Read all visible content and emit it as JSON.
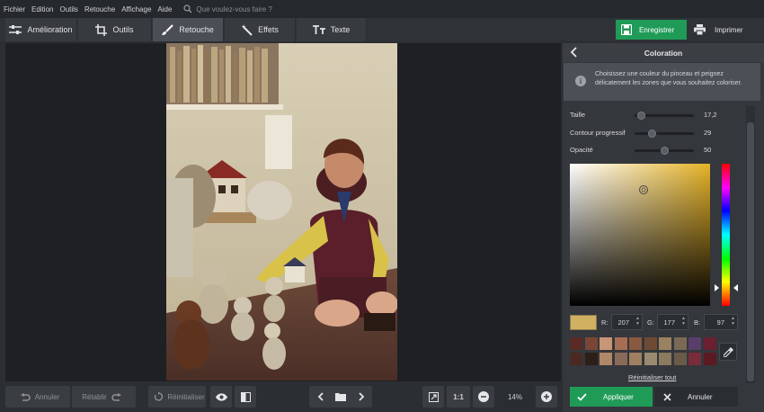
{
  "menu": [
    "Fichier",
    "Edition",
    "Outils",
    "Retouche",
    "Affichage",
    "Aide"
  ],
  "search": {
    "placeholder": "Que voulez-vous faire ?"
  },
  "tabs": [
    {
      "label": "Amélioration",
      "icon": "sliders-icon",
      "active": false
    },
    {
      "label": "Outils",
      "icon": "crop-icon",
      "active": false
    },
    {
      "label": "Retouche",
      "icon": "brush-icon",
      "active": true
    },
    {
      "label": "Effets",
      "icon": "magic-wand-icon",
      "active": false
    },
    {
      "label": "Texte",
      "icon": "text-icon",
      "active": false
    }
  ],
  "actions": {
    "save_label": "Enregistrer",
    "print_label": "Imprimer"
  },
  "bottom": {
    "undo_label": "Annuler",
    "redo_label": "Rétablir",
    "reset_label": "Réinitialiser",
    "ratio_label": "1:1",
    "zoom_value": "14%"
  },
  "panel": {
    "title": "Coloration",
    "info": "Choisissez une couleur du pinceau et peignez délicatement les zones que vous souhaitez coloriser.",
    "sliders": [
      {
        "label": "Taille",
        "value": "17,2",
        "level": 0.1
      },
      {
        "label": "Contour progressif",
        "value": "29",
        "level": 0.29
      },
      {
        "label": "Opacité",
        "value": "50",
        "level": 0.5
      }
    ],
    "rgb": {
      "r_label": "R:",
      "r": "207",
      "g_label": "G:",
      "g": "177",
      "b_label": "B:",
      "b": "97"
    },
    "current_color": "#cfb161",
    "palette": [
      "#5a2a24",
      "#7a4535",
      "#c89676",
      "#a56e52",
      "#8a5a40",
      "#6e4a35",
      "#9a8260",
      "#7a6a55",
      "#5a3e6a",
      "#6a2030",
      "#4a2a20",
      "#2e1e18",
      "#b08868",
      "#8a6a58",
      "#a08060",
      "#9a8a70",
      "#8a7a60",
      "#6a5a48",
      "#7a2c3a",
      "#5a1a22"
    ],
    "reset_all_label": "Réinitialiser tout",
    "apply_label": "Appliquer",
    "cancel_label": "Annuler"
  }
}
